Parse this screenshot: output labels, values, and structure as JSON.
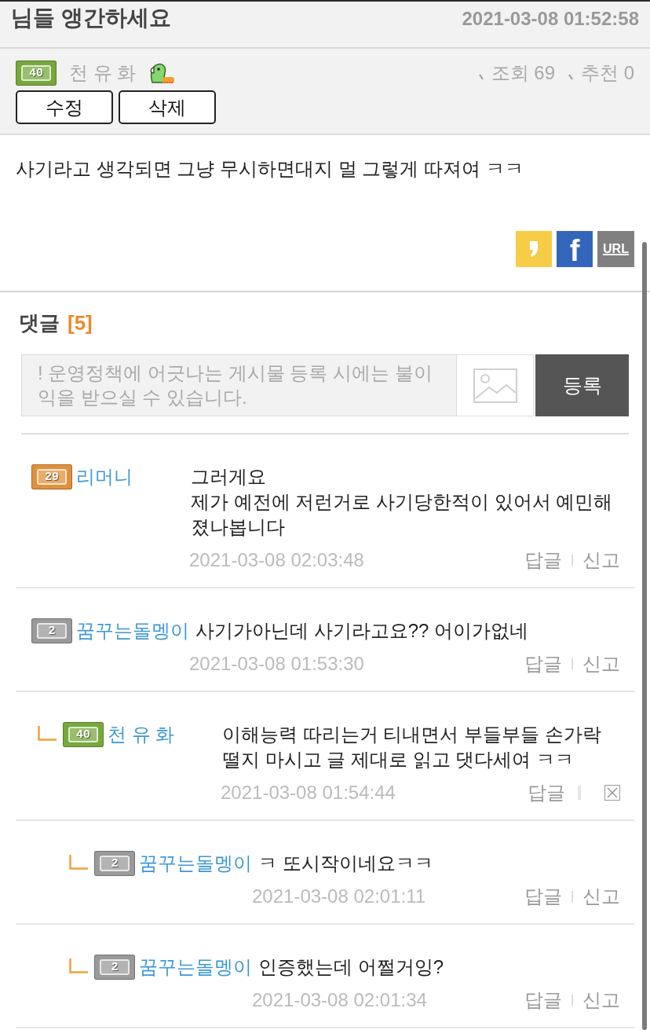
{
  "post": {
    "title": "님들 앵간하세요",
    "date": "2021-03-08 01:52:58",
    "author": {
      "name": "천 유 화",
      "badge": {
        "text": "40",
        "color": "#77a83b"
      }
    },
    "stats": [
      "조회 69",
      "추천 0"
    ],
    "buttons": [
      "수정",
      "삭제"
    ],
    "body": "사기라고 생각되면 그냥 무시하면대지 멀 그렇게 따져여 ㅋㅋ",
    "share": [
      {
        "kind": "kakao"
      },
      {
        "kind": "facebook",
        "label": "f"
      },
      {
        "kind": "url",
        "label": "URL"
      }
    ]
  },
  "comments": {
    "title": "댓글",
    "count": "[5]",
    "form": {
      "placeholder": "! 운영정책에 어긋나는 게시물 등록 시에는 불이익을 받으실 수 있습니다.",
      "submit": "등록"
    },
    "items": [
      {
        "author": {
          "name": "리머니",
          "badge": {
            "text": "29",
            "color": "#e0913a"
          }
        },
        "text": "그러게요\n제가 예전에 저런거로 사기당한적이 있어서 예민해졌나봅니다",
        "date": "2021-03-08 02:03:48",
        "actions": [
          {
            "kind": "link",
            "label": "답글"
          },
          {
            "kind": "link",
            "label": "신고"
          }
        ]
      },
      {
        "author": {
          "name": "꿈꾸는돌멩이",
          "badge": {
            "text": "2",
            "color": "#9a9a9a"
          }
        },
        "text": "사기가아닌데 사기라고요?? 어이가없네",
        "date": "2021-03-08 01:53:30",
        "actions": [
          {
            "kind": "link",
            "label": "답글"
          },
          {
            "kind": "link",
            "label": "신고"
          }
        ],
        "children": [
          {
            "author": {
              "name": "천 유 화",
              "badge": {
                "text": "40",
                "color": "#77a83b"
              }
            },
            "text": "이해능력 따리는거 티내면서 부들부들 손가락 떨지 마시고 글 제대로 읽고 댓다세여 ㅋㅋ",
            "date": "2021-03-08 01:54:44",
            "actions": [
              {
                "kind": "link",
                "label": "답글"
              },
              {
                "kind": "delete"
              }
            ],
            "children": [
              {
                "author": {
                  "name": "꿈꾸는돌멩이",
                  "badge": {
                    "text": "2",
                    "color": "#9a9a9a"
                  }
                },
                "text": "ㅋ 또시작이네요ㅋㅋ",
                "date": "2021-03-08 02:01:11",
                "actions": [
                  {
                    "kind": "link",
                    "label": "답글"
                  },
                  {
                    "kind": "link",
                    "label": "신고"
                  }
                ]
              },
              {
                "author": {
                  "name": "꿈꾸는돌멩이",
                  "badge": {
                    "text": "2",
                    "color": "#9a9a9a"
                  }
                },
                "text": "인증했는데 어쩔거잉?",
                "date": "2021-03-08 02:01:34",
                "actions": [
                  {
                    "kind": "link",
                    "label": "답글"
                  },
                  {
                    "kind": "link",
                    "label": "신고"
                  }
                ]
              }
            ]
          }
        ]
      }
    ]
  }
}
